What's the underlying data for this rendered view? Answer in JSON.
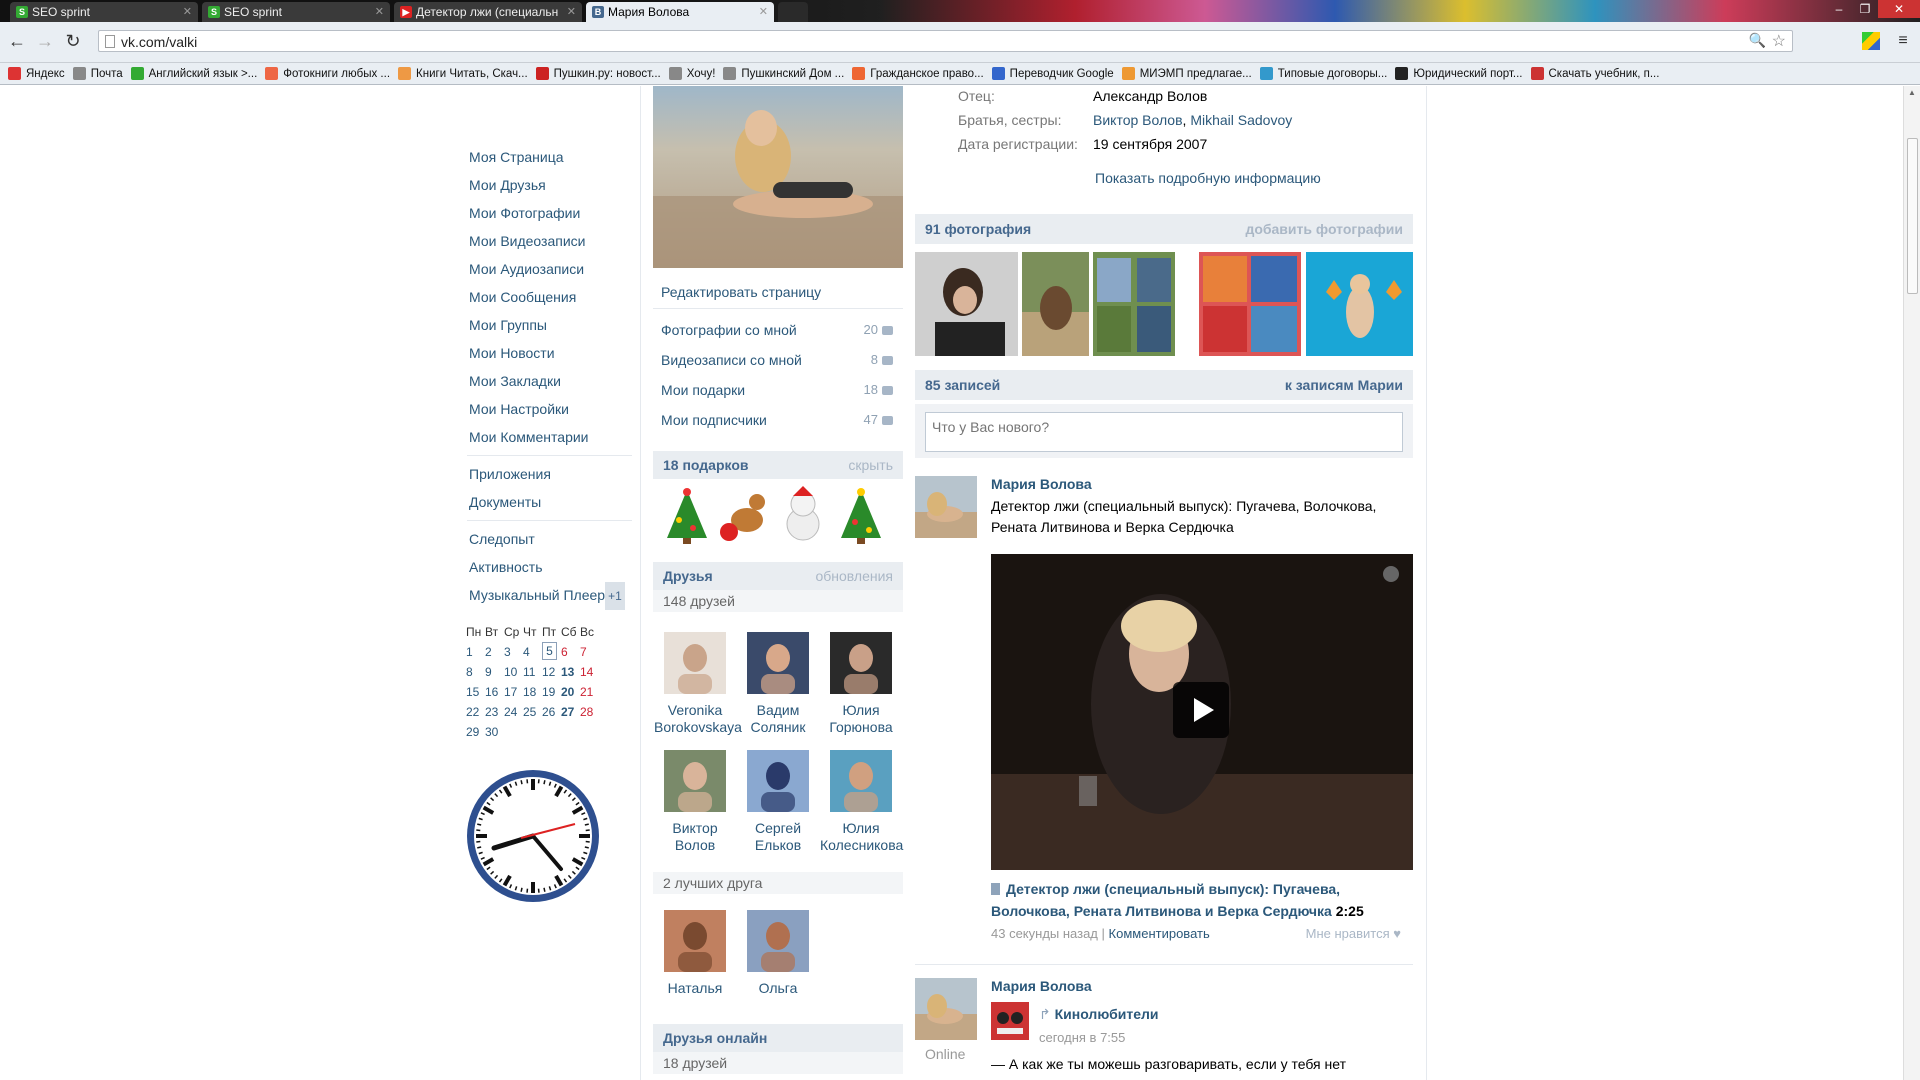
{
  "browser": {
    "tabs": [
      {
        "title": "SEO sprint",
        "icon": "seosprint-favicon",
        "active": false
      },
      {
        "title": "SEO sprint",
        "icon": "seosprint-favicon",
        "active": false
      },
      {
        "title": "Детектор лжи (специальн",
        "icon": "youtube-favicon",
        "active": false
      },
      {
        "title": "Мария Волова",
        "icon": "vk-favicon",
        "active": true
      }
    ],
    "url": "vk.com/valki",
    "bookmarks": [
      {
        "label": "Яндекс",
        "color": "#d33"
      },
      {
        "label": "Почта",
        "color": "#888"
      },
      {
        "label": "Английский язык >...",
        "color": "#3a3"
      },
      {
        "label": "Фотокниги любых ...",
        "color": "#e64"
      },
      {
        "label": "Книги Читать, Скач...",
        "color": "#e94"
      },
      {
        "label": "Пушкин.ру: новост...",
        "color": "#c22"
      },
      {
        "label": "Хочу!",
        "color": "#888"
      },
      {
        "label": "Пушкинский Дом ...",
        "color": "#888"
      },
      {
        "label": "Гражданское право...",
        "color": "#e63"
      },
      {
        "label": "Переводчик Google",
        "color": "#36c"
      },
      {
        "label": "МИЭМП предлагае...",
        "color": "#e93"
      },
      {
        "label": "Типовые договоры...",
        "color": "#39c"
      },
      {
        "label": "Юридический порт...",
        "color": "#222"
      },
      {
        "label": "Скачать учебник, п...",
        "color": "#c33"
      }
    ]
  },
  "left_menu": {
    "items": [
      "Моя Страница",
      "Мои Друзья",
      "Мои Фотографии",
      "Мои Видеозаписи",
      "Мои Аудиозаписи",
      "Мои Сообщения",
      "Мои Группы",
      "Мои Новости",
      "Мои Закладки",
      "Мои Настройки",
      "Мои Комментарии"
    ],
    "items2": [
      "Приложения",
      "Документы"
    ],
    "items3": [
      "Следопыт",
      "Активность"
    ],
    "player": "Музыкальный Плеер",
    "player_badge": "+1"
  },
  "calendar": {
    "headers": [
      "Пн",
      "Вт",
      "Ср",
      "Чт",
      "Пт",
      "Сб",
      "Вс"
    ],
    "weeks": [
      [
        "1",
        "2",
        "3",
        "4",
        "5",
        "6",
        "7"
      ],
      [
        "8",
        "9",
        "10",
        "11",
        "12",
        "13",
        "14"
      ],
      [
        "15",
        "16",
        "17",
        "18",
        "19",
        "20",
        "21"
      ],
      [
        "22",
        "23",
        "24",
        "25",
        "26",
        "27",
        "28"
      ],
      [
        "29",
        "30",
        "",
        "",
        "",
        "",
        ""
      ]
    ],
    "today": "5"
  },
  "profile_links": {
    "edit": "Редактировать страницу",
    "items": [
      {
        "label": "Фотографии со мной",
        "count": "20",
        "icon": "camera-icon"
      },
      {
        "label": "Видеозаписи со мной",
        "count": "8",
        "icon": "film-icon"
      },
      {
        "label": "Мои подарки",
        "count": "18",
        "icon": "gift-icon"
      },
      {
        "label": "Мои подписчики",
        "count": "47",
        "icon": "person-icon"
      }
    ]
  },
  "gifts": {
    "title": "18 подарков",
    "action": "скрыть"
  },
  "friends": {
    "title": "Друзья",
    "action": "обновления",
    "count": "148 друзей",
    "list": [
      {
        "first": "Veronika",
        "last": "Borokovskaya"
      },
      {
        "first": "Вадим",
        "last": "Соляник"
      },
      {
        "first": "Юлия",
        "last": "Горюнова"
      },
      {
        "first": "Виктор",
        "last": "Волов"
      },
      {
        "first": "Сергей",
        "last": "Ельков"
      },
      {
        "first": "Юлия",
        "last": "Колесникова"
      }
    ],
    "best_title": "2 лучших друга",
    "best": [
      "Наталья",
      "Ольга"
    ],
    "online_title": "Друзья онлайн",
    "online_count": "18 друзей"
  },
  "info": {
    "father_label": "Отец:",
    "father": "Александр Волов",
    "siblings_label": "Братья, сестры:",
    "sibling1": "Виктор Волов",
    "sibling_sep": ",",
    "sibling2": "Mikhail Sadovoy",
    "reg_label": "Дата регистрации:",
    "reg_date": "19 сентября 2007",
    "show_more": "Показать подробную информацию"
  },
  "photos": {
    "title": "91 фотография",
    "action": "добавить фотографии"
  },
  "wall": {
    "title": "85 записей",
    "action": "к записям Марии",
    "placeholder": "Что у Вас нового?"
  },
  "post1": {
    "author": "Мария Волова",
    "text": "Детектор лжи (специальный выпуск): Пугачева, Волочкова, Рената Литвинова и Верка Сердючка",
    "video_title": "Детектор лжи (специальный выпуск): Пугачева, Волочкова, Рената Литвинова и Верка Сердючка",
    "duration": "2:25",
    "time": "43 секунды назад",
    "sep": "|",
    "comment": "Комментировать",
    "like": "Мне нравится"
  },
  "post2": {
    "author": "Мария Волова",
    "status": "Online",
    "repost_from": "Кинолюбители",
    "repost_time": "сегодня в 7:55",
    "text": "— А как же ты можешь разговаривать, если у тебя нет"
  },
  "colors": {
    "link": "#2b587a",
    "header_bg": "#e9edf1",
    "header_text": "#45688e"
  }
}
